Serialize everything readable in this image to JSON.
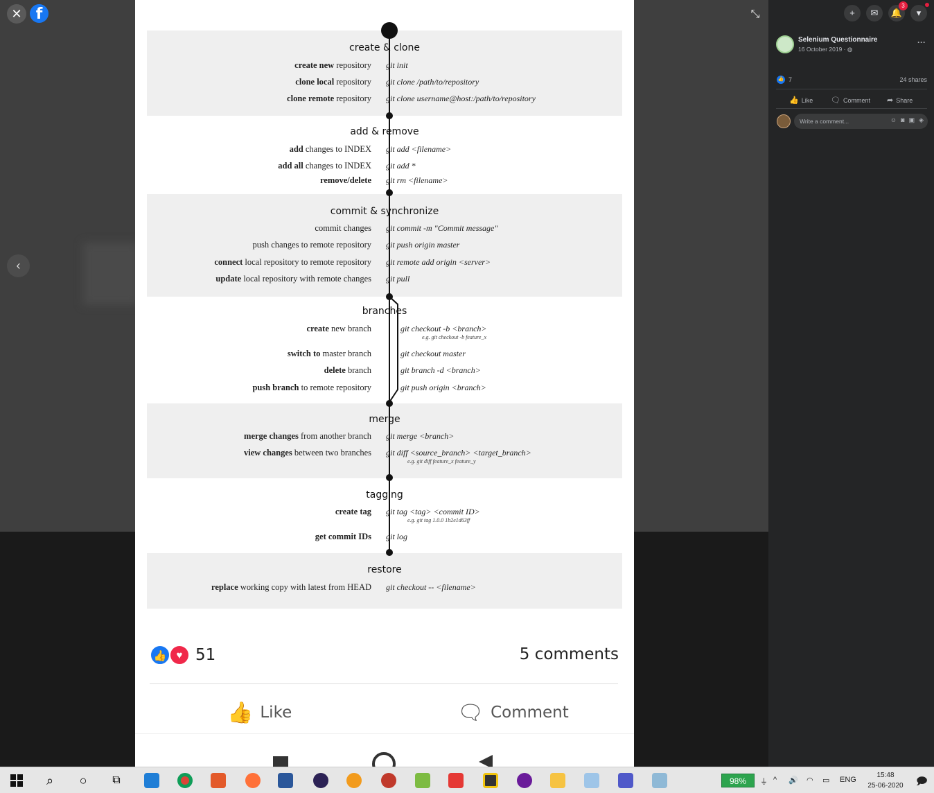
{
  "viewer": {
    "close_glyph": "✕",
    "logo_glyph": "f",
    "prev_glyph": "‹",
    "fullscreen_glyph": "⤡"
  },
  "cheatsheet": {
    "sections": [
      {
        "title": "create & clone",
        "rows": [
          {
            "bold": "create new",
            "rest": " repository",
            "cmd": "git init"
          },
          {
            "bold": "clone local",
            "rest": " repository",
            "cmd": "git clone /path/to/repository"
          },
          {
            "bold": "clone remote",
            "rest": " repository",
            "cmd": "git clone username@host:/path/to/repository"
          }
        ]
      },
      {
        "title": "add & remove",
        "rows": [
          {
            "bold": "add",
            "rest": " changes to INDEX",
            "cmd": "git add <filename>"
          },
          {
            "bold": "add all",
            "rest": " changes to INDEX",
            "cmd": "git add *"
          },
          {
            "bold": "remove/delete",
            "rest": "",
            "cmd": "git rm <filename>"
          }
        ]
      },
      {
        "title": "commit & synchronize",
        "rows": [
          {
            "bold": "",
            "rest": "commit changes",
            "cmd": "git commit -m \"Commit message\""
          },
          {
            "bold": "",
            "rest": "push changes to remote repository",
            "cmd": "git push origin master"
          },
          {
            "bold": "connect",
            "rest": " local repository to remote repository",
            "cmd": "git remote add origin <server>"
          },
          {
            "bold": "update",
            "rest": " local repository with remote changes",
            "cmd": "git pull"
          }
        ]
      },
      {
        "title": "branches",
        "rows": [
          {
            "bold": "create",
            "rest": " new branch",
            "cmd": "git checkout -b <branch>",
            "example": "e.g. git checkout -b feature_x"
          },
          {
            "bold": "switch to",
            "rest": " master branch",
            "cmd": "git checkout master"
          },
          {
            "bold": "delete",
            "rest": " branch",
            "cmd": "git branch -d <branch>"
          },
          {
            "bold": "push branch",
            "rest": " to remote repository",
            "cmd": "git push origin <branch>"
          }
        ]
      },
      {
        "title": "merge",
        "rows": [
          {
            "bold": "merge changes",
            "rest": " from another branch",
            "cmd": "git merge <branch>"
          },
          {
            "bold": "view changes",
            "rest": " between two branches",
            "cmd": "git diff <source_branch> <target_branch>",
            "example": "e.g. git diff feature_x feature_y"
          }
        ]
      },
      {
        "title": "tagging",
        "rows": [
          {
            "bold": "create tag",
            "rest": "",
            "cmd": "git tag <tag> <commit ID>",
            "example": "e.g. git tag 1.0.0 1b2e1d63ff"
          },
          {
            "bold": "get commit IDs",
            "rest": "",
            "cmd": "git log"
          }
        ]
      },
      {
        "title": "restore",
        "rows": [
          {
            "bold": "replace",
            "rest": " working copy with latest from HEAD",
            "cmd": "git checkout -- <filename>"
          }
        ]
      }
    ]
  },
  "card": {
    "reaction_count": "51",
    "comments_count": "5 comments",
    "like_label": "Like",
    "comment_label": "Comment",
    "like_icon": "thumbs-up-icon",
    "comment_icon": "speech-bubble-icon"
  },
  "panel": {
    "page_name": "Selenium Questionnaire",
    "post_date": "16 October 2019 · ",
    "like_count": "7",
    "shares": "24 shares",
    "actions": {
      "like": "Like",
      "comment": "Comment",
      "share": "Share"
    },
    "comment_placeholder": "Write a comment...",
    "notification_badge": "3"
  },
  "taskbar": {
    "battery": "98%",
    "language": "ENG",
    "time": "15:48",
    "date": "25-06-2020"
  },
  "colors": {
    "facebook_blue": "#1877f2",
    "love_red": "#f0284a",
    "panel_bg": "#242526",
    "battery_green": "#2da44e"
  }
}
